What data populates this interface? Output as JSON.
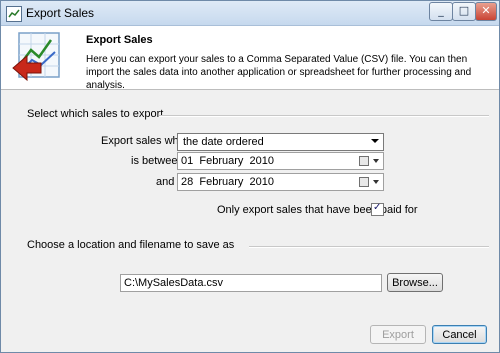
{
  "window": {
    "title": "Export Sales"
  },
  "header": {
    "title": "Export Sales",
    "description": "Here you can export your sales to a Comma Separated Value (CSV) file. You can then import the sales data into another application or spreadsheet for further processing and analysis."
  },
  "select_section": {
    "heading": "Select which sales to export",
    "export_where_label": "Export sales where",
    "export_where_value": "the date ordered",
    "between_label": "is between",
    "from_date": {
      "day": "01",
      "month": "February",
      "year": "2010"
    },
    "and_label": "and",
    "to_date": {
      "day": "28",
      "month": "February",
      "year": "2010"
    },
    "paid_only_label": "Only export sales that have been paid for",
    "paid_only_checked": true
  },
  "location_section": {
    "heading": "Choose a location and filename to save as",
    "filename": "C:\\MySalesData.csv",
    "browse_label": "Browse..."
  },
  "footer": {
    "export_label": "Export",
    "cancel_label": "Cancel"
  },
  "icons": {
    "app": "spreadsheet-icon",
    "header": "export-chart-arrow-icon",
    "calendar": "calendar-icon"
  }
}
